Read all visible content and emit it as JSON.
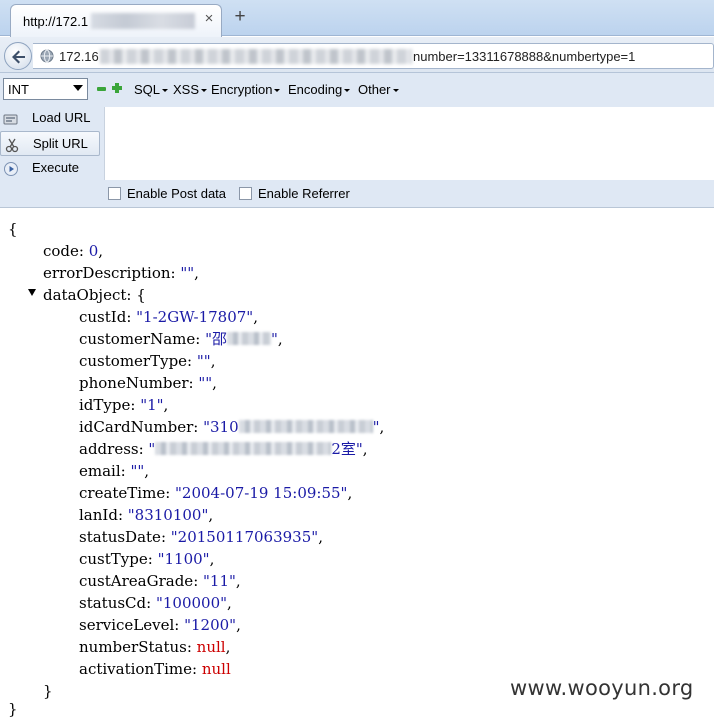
{
  "browser": {
    "tab": {
      "title": "http://172.1",
      "close_glyph": "×"
    },
    "new_tab_glyph": "+",
    "address": {
      "url_prefix": "172.16",
      "url_suffix": "number=13311678888&numbertype=1"
    }
  },
  "hackbar": {
    "select_value": "INT",
    "menus": [
      "SQL",
      "XSS",
      "Encryption",
      "Encoding",
      "Other"
    ],
    "side_buttons": {
      "load_url": "Load URL",
      "split_url": "Split URL",
      "execute": "Execute"
    },
    "enable_post": "Enable Post data",
    "enable_referrer": "Enable Referrer",
    "icons": [
      "minus-icon",
      "plus-icon",
      "load-url-icon",
      "split-url-icon",
      "execute-icon"
    ],
    "colors": {
      "toolbar_bg": "#dfe8f4",
      "plus_minus": "#3aa53a"
    }
  },
  "json": {
    "open_brace": "{",
    "close_brace": "}",
    "code_key": "code",
    "code_val": "0",
    "error_key": "errorDescription",
    "error_val": "\"\"",
    "dataobject_key": "dataObject",
    "dataobject_close": "}",
    "fields": {
      "custId": {
        "key": "custId",
        "val": "\"1-2GW-17807\""
      },
      "customerName_key": "customerName",
      "customerName_visible": "\"邵",
      "customerType": {
        "key": "customerType",
        "val": "\"\""
      },
      "phoneNumber": {
        "key": "phoneNumber",
        "val": "\"\""
      },
      "idType": {
        "key": "idType",
        "val": "\"1\""
      },
      "idCardNumber_key": "idCardNumber",
      "idCardNumber_visible": "\"310",
      "address_key": "address",
      "address_tail": "2室\"",
      "email": {
        "key": "email",
        "val": "\"\""
      },
      "createTime": {
        "key": "createTime",
        "val": "\"2004-07-19 15:09:55\""
      },
      "lanId": {
        "key": "lanId",
        "val": "\"8310100\""
      },
      "statusDate": {
        "key": "statusDate",
        "val": "\"20150117063935\""
      },
      "custType": {
        "key": "custType",
        "val": "\"1100\""
      },
      "custAreaGrade": {
        "key": "custAreaGrade",
        "val": "\"11\""
      },
      "statusCd": {
        "key": "statusCd",
        "val": "\"100000\""
      },
      "serviceLevel": {
        "key": "serviceLevel",
        "val": "\"1200\""
      },
      "numberStatus": {
        "key": "numberStatus",
        "val": "null"
      },
      "activationTime": {
        "key": "activationTime",
        "val": "null"
      }
    },
    "colors": {
      "string": "#1a1aa6",
      "null": "#cc0000"
    }
  },
  "watermark": "www.wooyun.org"
}
